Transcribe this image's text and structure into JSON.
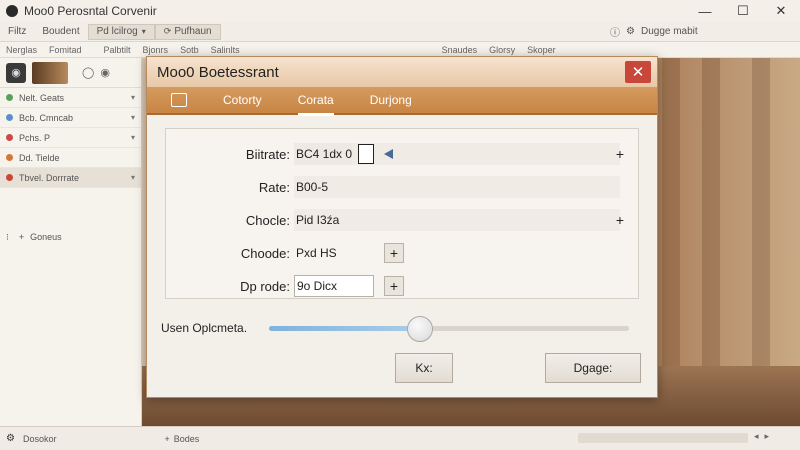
{
  "window": {
    "title": "Moo0 Perosntal Corvenir",
    "controls": {
      "minimize": "—",
      "maximize": "☐",
      "close": "✕"
    }
  },
  "menubar": {
    "items": [
      "Filtz",
      "Boudent",
      "Pd lcilrog",
      "Pufhaun"
    ],
    "right_label": "Dugge mabit"
  },
  "toolbar2": {
    "items": [
      "Nerglas",
      "Fomitad",
      "Palbtilt",
      "Bjonrs",
      "Sotb",
      "Salinlts",
      "Snaudes",
      "Glorsy",
      "Skoper"
    ]
  },
  "sidebar": {
    "rows": [
      {
        "label": "Nelt. Geats",
        "color": "#5aa05a"
      },
      {
        "label": "Bcb. Cmncab",
        "color": "#5a8fc8"
      },
      {
        "label": "Pchs. P",
        "color": "#c84a4a"
      },
      {
        "label": "Dd. Tielde",
        "color": "#d07a3a"
      },
      {
        "label": "Tbvel. Dorrrate",
        "color": "#c9463a"
      }
    ],
    "bottom_label": "Goneus"
  },
  "statusbar": {
    "left_label": "Dosokor",
    "right_label": "Bodes"
  },
  "dialog": {
    "title": "Moo0 Boetessrant",
    "close": "✕",
    "tabs": [
      "Cotorty",
      "Corata",
      "Durjong"
    ],
    "active_tab": 1,
    "fields": {
      "bitrate": {
        "label": "Biitrate:",
        "value": "BC4 1dx 0"
      },
      "rate": {
        "label": "Rate:",
        "value": "B00-5"
      },
      "choice1": {
        "label": "Chocle:",
        "value": "Pid I3źa"
      },
      "choice2": {
        "label": "Choode:",
        "value": "Pxd HS"
      },
      "mode": {
        "label": "Dp rode:",
        "value": "9o Dicx"
      }
    },
    "slider": {
      "label": "Usen Oplcmeta.",
      "value_fraction": 0.42
    },
    "buttons": {
      "ok": "Kx:",
      "secondary": "Dgage:"
    },
    "plus": "+"
  },
  "colors": {
    "tab_bar": "#c88544",
    "close_button": "#c9463a",
    "slider_fill": "#7fb2dd"
  }
}
